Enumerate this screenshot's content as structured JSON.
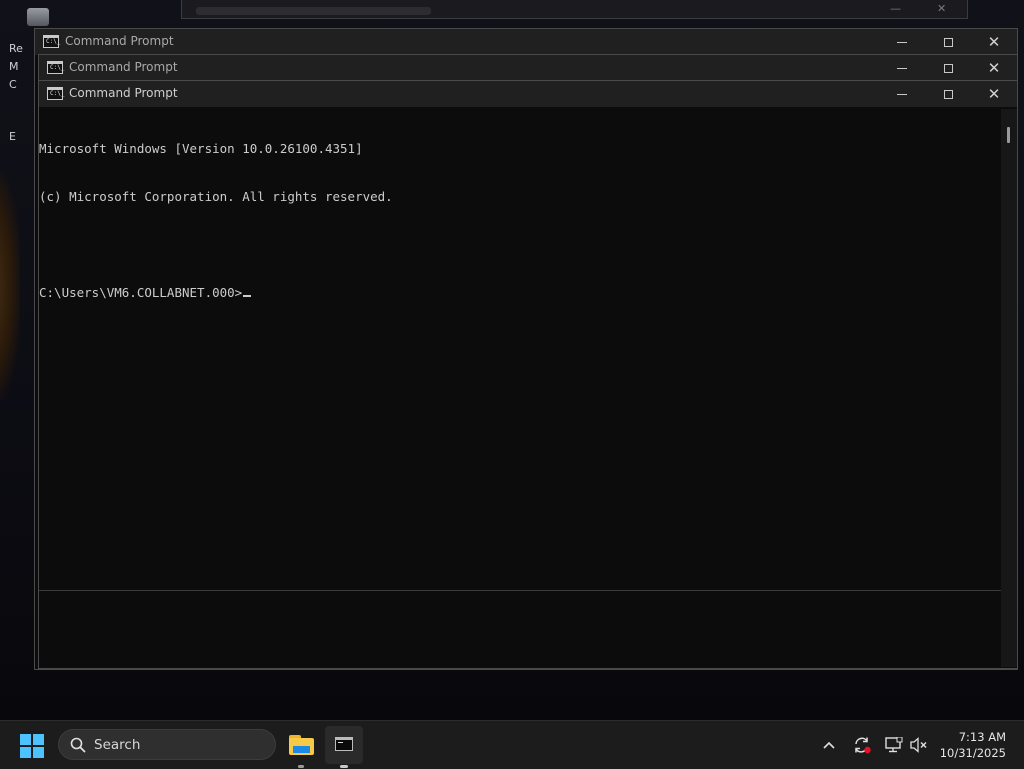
{
  "desktop": {
    "icon_label": "Re",
    "fragments": [
      "M",
      "C",
      "E"
    ]
  },
  "windows": [
    {
      "title": "Command Prompt",
      "icon_text": "C:\\_"
    },
    {
      "title": "Command Prompt",
      "icon_text": "C:\\_"
    },
    {
      "title": "Command Prompt",
      "icon_text": "C:\\_"
    }
  ],
  "console": {
    "lines": [
      "Microsoft Windows [Version 10.0.26100.4351]",
      "(c) Microsoft Corporation. All rights reserved.",
      "",
      "C:\\Users\\VM6.COLLABNET.000>"
    ]
  },
  "taskbar": {
    "search_placeholder": "Search",
    "apps": [
      {
        "name": "File Explorer",
        "icon": "folder-icon"
      },
      {
        "name": "Command Prompt",
        "icon": "terminal-icon",
        "active": true
      }
    ],
    "tray_icons": [
      "chevron-up-icon",
      "sync-icon",
      "network-icon",
      "volume-muted-icon"
    ],
    "clock": {
      "time": "7:13 AM",
      "date": "10/31/2025"
    }
  },
  "colors": {
    "accent": "#4cc2ff",
    "console_bg": "#0c0c0c",
    "console_text": "#cccccc",
    "titlebar": "#202020",
    "taskbar": "#1c1c1c"
  }
}
